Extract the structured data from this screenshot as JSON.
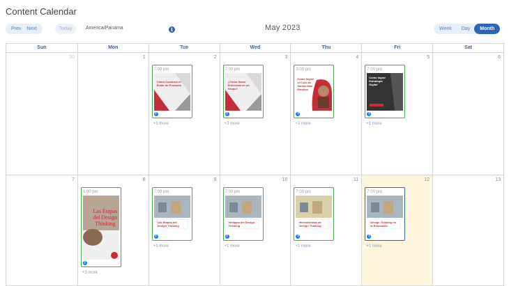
{
  "app": {
    "title": "Content Calendar"
  },
  "nav": {
    "prev": "Prev",
    "next": "Next",
    "today": "Today",
    "timezone": "America/Panama",
    "info_icon": "info-icon",
    "month_label": "May 2023"
  },
  "views": [
    {
      "label": "Week",
      "active": false
    },
    {
      "label": "Day",
      "active": false
    },
    {
      "label": "Month",
      "active": true
    }
  ],
  "weekdays": [
    "Sun",
    "Mon",
    "Tue",
    "Wed",
    "Thu",
    "Fri",
    "Sat"
  ],
  "weeks": [
    {
      "days": [
        {
          "num": "30",
          "other": true
        },
        {
          "num": "1"
        },
        {
          "num": "2",
          "post": {
            "time": "7:00 pm",
            "text": "Cómo Construir el Estilo de Producto",
            "style": "tri",
            "more": "+1 more"
          }
        },
        {
          "num": "3",
          "post": {
            "time": "7:00 pm",
            "text": "¿Cómo Hacer Entrevista en un Grupo?",
            "style": "tri",
            "more": "+3 more"
          }
        },
        {
          "num": "4",
          "post": {
            "time": "3:00 pm",
            "text": "Cómo lograr el Ciclo de Ventas Más Efectivo",
            "style": "person",
            "more": "+3 more"
          }
        },
        {
          "num": "5",
          "post": {
            "time": "7:00 pm",
            "text": "Cómo lograr Estrategia Digital",
            "style": "dark",
            "more": "+1 more"
          }
        },
        {
          "num": "6"
        }
      ]
    },
    {
      "days": [
        {
          "num": "7"
        },
        {
          "num": "8",
          "post": {
            "time": "1:00 pm",
            "text": "Las Etapas del Design Thinking",
            "style": "tall",
            "more": "+3 more"
          }
        },
        {
          "num": "9",
          "post": {
            "time": "7:00 pm",
            "text": "Las Etapas del Design Thinking",
            "style": "photo",
            "more": "+1 more"
          }
        },
        {
          "num": "10",
          "post": {
            "time": "7:00 pm",
            "text": "Ventajas del Design Thinking",
            "style": "photo",
            "more": "+1 more"
          }
        },
        {
          "num": "11",
          "post": {
            "time": "7:00 pm",
            "text": "Herramientas de Design Thinking",
            "style": "photo2",
            "more": "+1 more"
          }
        },
        {
          "num": "12",
          "today": true,
          "post": {
            "time": "7:00 pm",
            "text": "Design Thinking en la Educación",
            "style": "photo",
            "blue": true,
            "more": "+1 more"
          }
        },
        {
          "num": "13"
        }
      ]
    }
  ]
}
